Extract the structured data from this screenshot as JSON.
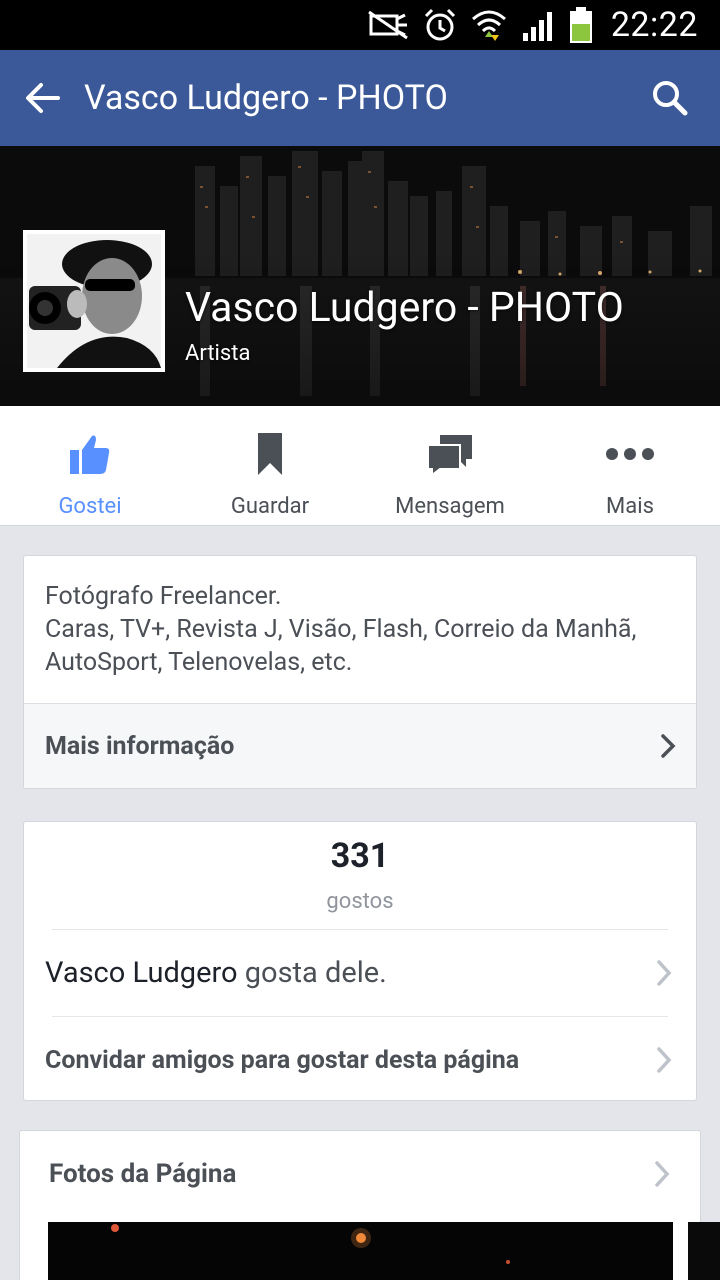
{
  "status_bar": {
    "time": "22:22",
    "icons": [
      "mute-icon",
      "alarm-icon",
      "wifi-icon",
      "signal-icon",
      "battery-icon"
    ]
  },
  "toolbar": {
    "title": "Vasco Ludgero - PHOTO",
    "back_icon": "back-arrow-icon",
    "search_icon": "search-icon",
    "color": "#3b5998"
  },
  "cover": {
    "page_name": "Vasco Ludgero - PHOTO",
    "category": "Artista"
  },
  "actions": [
    {
      "label": "Gostei",
      "icon": "thumbs-up-icon",
      "active": true
    },
    {
      "label": "Guardar",
      "icon": "bookmark-icon",
      "active": false
    },
    {
      "label": "Mensagem",
      "icon": "message-icon",
      "active": false
    },
    {
      "label": "Mais",
      "icon": "more-icon",
      "active": false
    }
  ],
  "about": {
    "line1": "Fotógrafo Freelancer.",
    "line2": "Caras, TV+, Revista J, Visão, Flash, Correio da Manhã, AutoSport, Telenovelas, etc.",
    "more_info_label": "Mais informação"
  },
  "likes": {
    "count": "331",
    "label": "gostos",
    "friend_name": "Vasco Ludgero",
    "friend_suffix": " gosta dele.",
    "invite_label": "Convidar amigos para gostar desta página"
  },
  "photos": {
    "title": "Fotos da Página"
  },
  "colors": {
    "accent": "#3b5998",
    "active_action": "#5890ff",
    "background": "#e4e5ea"
  }
}
